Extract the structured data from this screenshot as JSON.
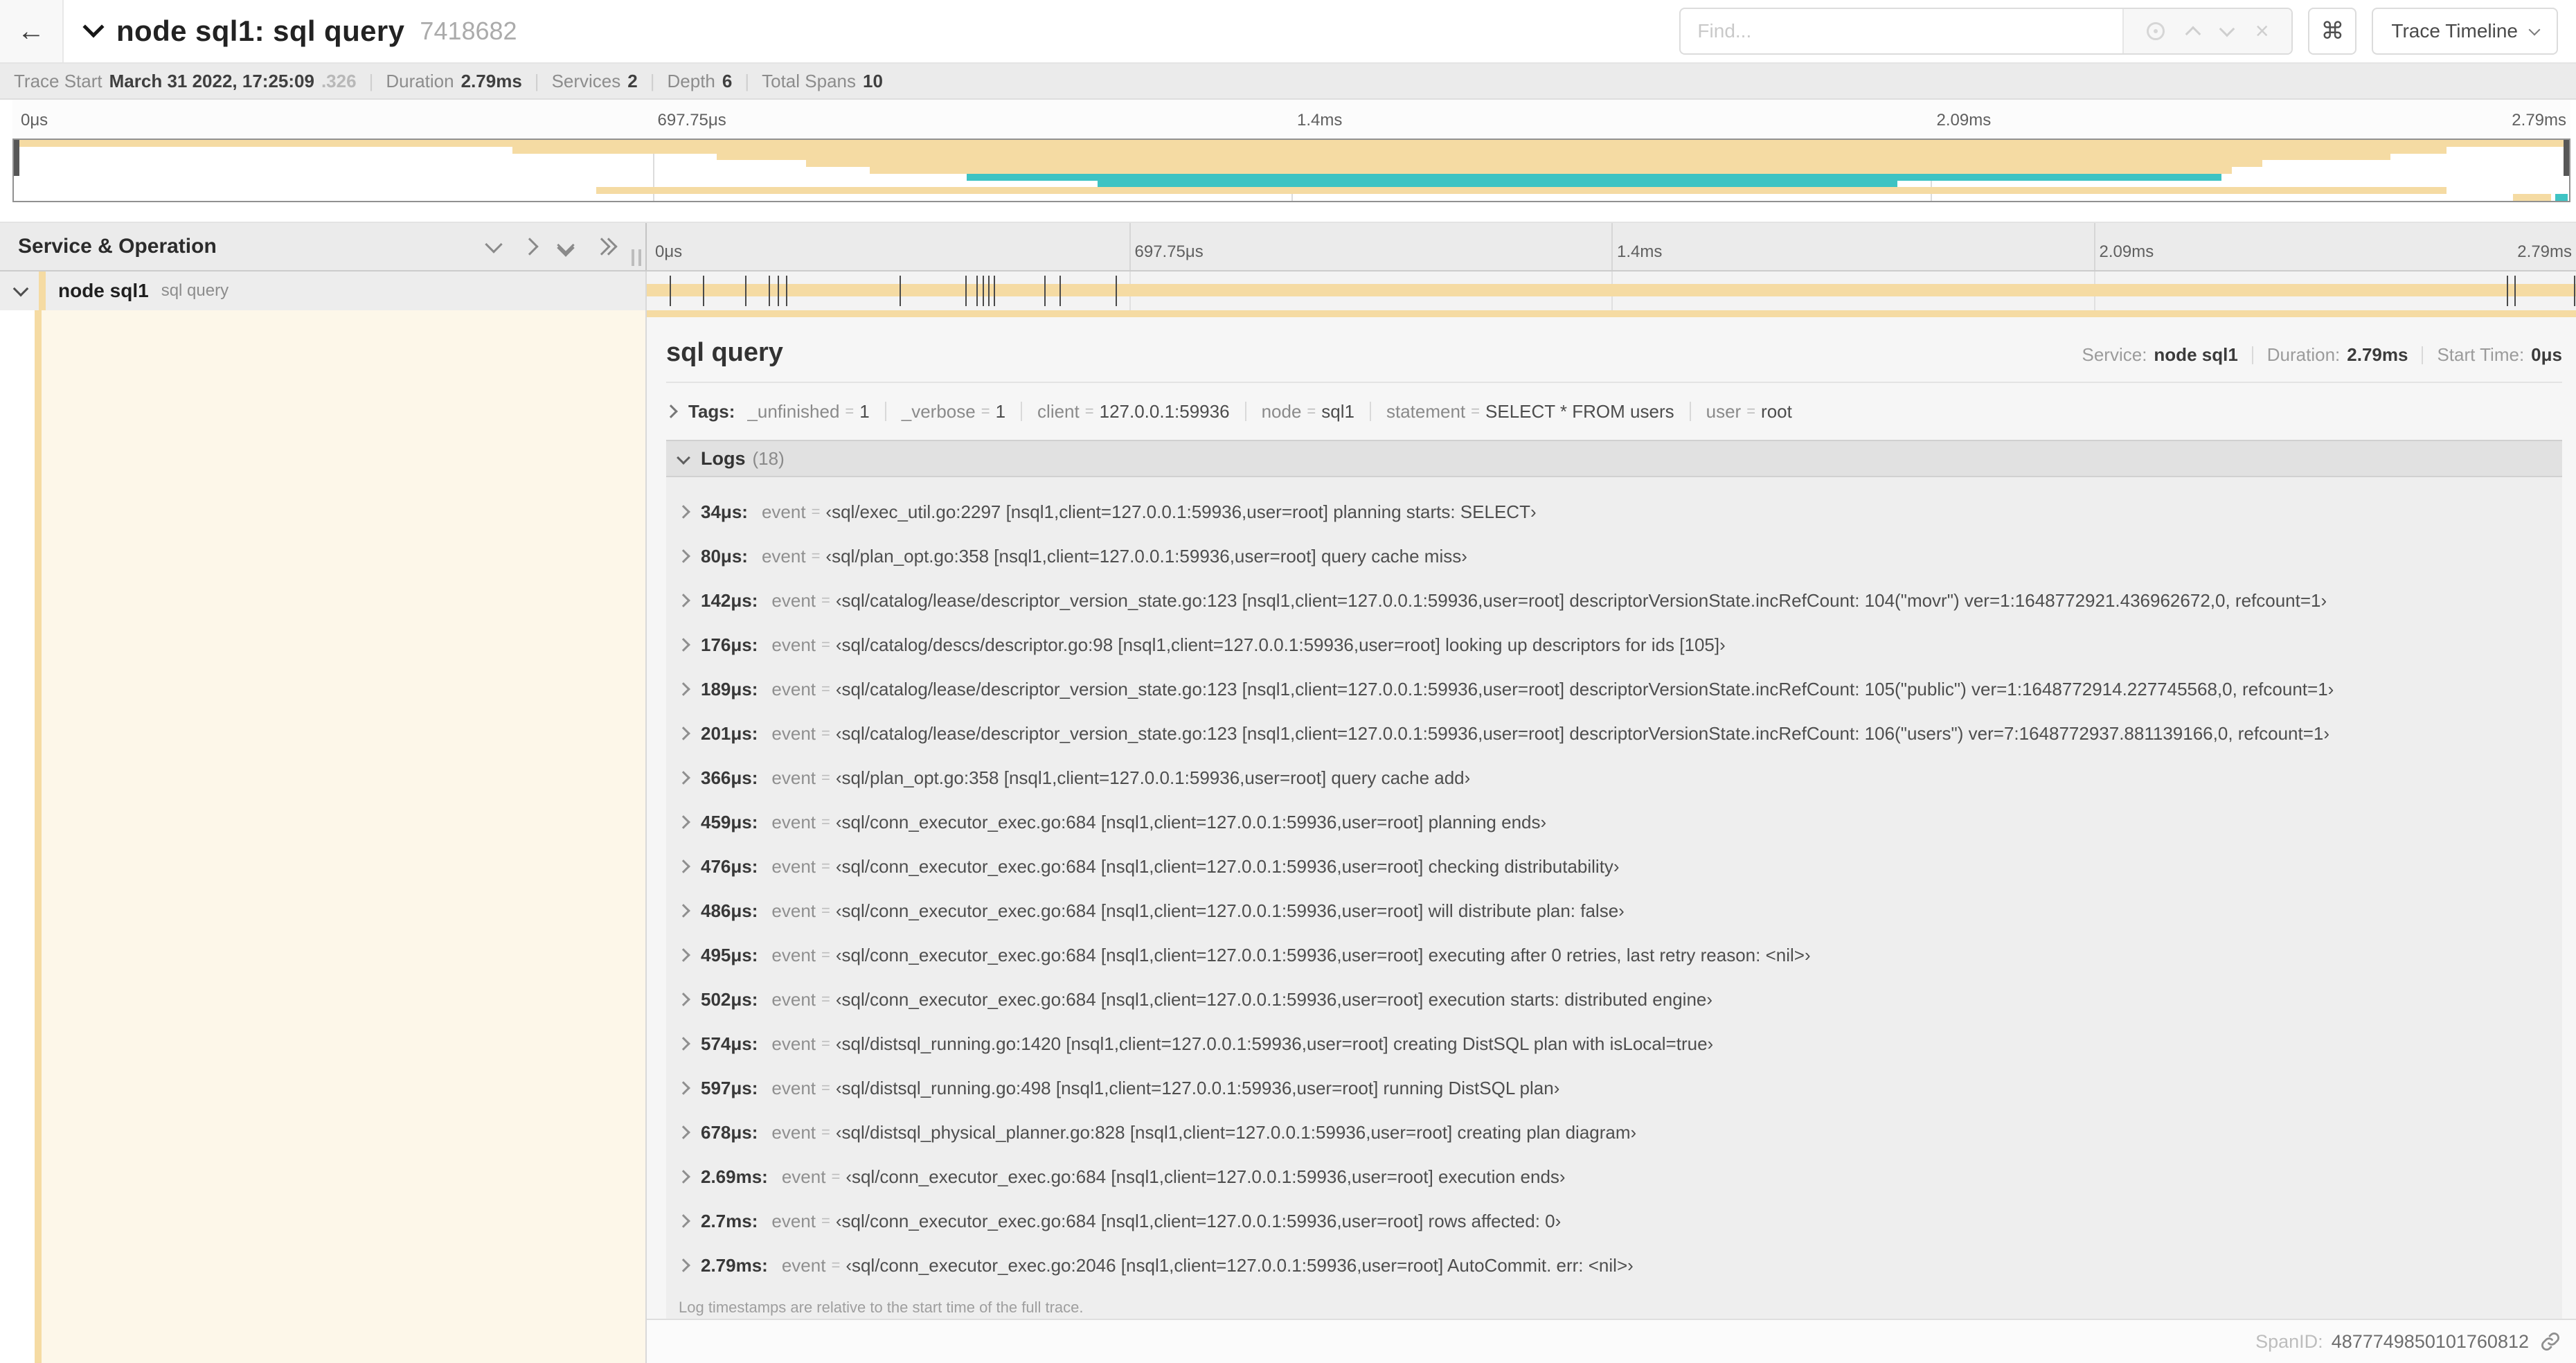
{
  "header": {
    "title": "node sql1: sql query",
    "trace_id": "7418682",
    "back_icon": "←",
    "find_placeholder": "Find...",
    "clear_icon": "×",
    "shortcut_icon": "⌘",
    "view_selector": "Trace Timeline"
  },
  "summary": {
    "items": [
      {
        "label": "Trace Start",
        "value": "March 31 2022, 17:25:09",
        "suffix": ".326"
      },
      {
        "label": "Duration",
        "value": "2.79ms"
      },
      {
        "label": "Services",
        "value": "2"
      },
      {
        "label": "Depth",
        "value": "6"
      },
      {
        "label": "Total Spans",
        "value": "10"
      }
    ]
  },
  "timeline": {
    "ticks": [
      {
        "label": "0μs",
        "pos": 0
      },
      {
        "label": "697.75μs",
        "pos": 25
      },
      {
        "label": "1.4ms",
        "pos": 50
      },
      {
        "label": "2.09ms",
        "pos": 75
      },
      {
        "label": "2.79ms",
        "pos": 100
      }
    ],
    "grid_positions": [
      25,
      50,
      75
    ],
    "minimap_rows": [
      [
        {
          "color": "tan",
          "start": 0,
          "end": 100
        }
      ],
      [
        {
          "color": "tan",
          "start": 19.5,
          "end": 95.2
        }
      ],
      [
        {
          "color": "tan",
          "start": 27.5,
          "end": 93
        }
      ],
      [
        {
          "color": "tan",
          "start": 31,
          "end": 88
        }
      ],
      [
        {
          "color": "tan",
          "start": 33.5,
          "end": 86.8
        }
      ],
      [
        {
          "color": "teal",
          "start": 37.3,
          "end": 86.4
        }
      ],
      [
        {
          "color": "teal",
          "start": 42.4,
          "end": 73.7
        }
      ],
      [
        {
          "color": "tan",
          "start": 22.8,
          "end": 95.2
        }
      ],
      [
        {
          "color": "tan",
          "start": 97.8,
          "end": 99.3
        },
        {
          "color": "teal",
          "start": 99.45,
          "end": 99.95
        }
      ]
    ]
  },
  "span_list": {
    "header": "Service & Operation",
    "row": {
      "service": "node sql1",
      "operation": "sql query"
    }
  },
  "span_row": {
    "bar_start": 0,
    "bar_end": 100,
    "tick_positions": [
      1.2,
      2.9,
      5.1,
      6.3,
      6.8,
      7.2,
      13.1,
      16.5,
      17.1,
      17.4,
      17.7,
      18,
      20.6,
      21.4,
      24.3,
      96.4,
      96.8,
      99.9
    ]
  },
  "detail": {
    "title": "sql query",
    "meta": [
      {
        "label": "Service:",
        "value": "node sql1"
      },
      {
        "label": "Duration:",
        "value": "2.79ms"
      },
      {
        "label": "Start Time:",
        "value": "0μs"
      }
    ],
    "tags_label": "Tags:",
    "tags": [
      {
        "key": "_unfinished",
        "value": "1"
      },
      {
        "key": "_verbose",
        "value": "1"
      },
      {
        "key": "client",
        "value": "127.0.0.1:59936"
      },
      {
        "key": "node",
        "value": "sql1"
      },
      {
        "key": "statement",
        "value": "SELECT * FROM users"
      },
      {
        "key": "user",
        "value": "root"
      }
    ],
    "logs_label": "Logs",
    "logs_count": "(18)",
    "logs": [
      {
        "time": "34μs:",
        "key": "event",
        "value": "‹sql/exec_util.go:2297 [nsql1,client=127.0.0.1:59936,user=root] planning starts: SELECT›"
      },
      {
        "time": "80μs:",
        "key": "event",
        "value": "‹sql/plan_opt.go:358 [nsql1,client=127.0.0.1:59936,user=root] query cache miss›"
      },
      {
        "time": "142μs:",
        "key": "event",
        "value": "‹sql/catalog/lease/descriptor_version_state.go:123 [nsql1,client=127.0.0.1:59936,user=root] descriptorVersionState.incRefCount: 104(\"movr\") ver=1:1648772921.436962672,0, refcount=1›"
      },
      {
        "time": "176μs:",
        "key": "event",
        "value": "‹sql/catalog/descs/descriptor.go:98 [nsql1,client=127.0.0.1:59936,user=root] looking up descriptors for ids [105]›"
      },
      {
        "time": "189μs:",
        "key": "event",
        "value": "‹sql/catalog/lease/descriptor_version_state.go:123 [nsql1,client=127.0.0.1:59936,user=root] descriptorVersionState.incRefCount: 105(\"public\") ver=1:1648772914.227745568,0, refcount=1›"
      },
      {
        "time": "201μs:",
        "key": "event",
        "value": "‹sql/catalog/lease/descriptor_version_state.go:123 [nsql1,client=127.0.0.1:59936,user=root] descriptorVersionState.incRefCount: 106(\"users\") ver=7:1648772937.881139166,0, refcount=1›"
      },
      {
        "time": "366μs:",
        "key": "event",
        "value": "‹sql/plan_opt.go:358 [nsql1,client=127.0.0.1:59936,user=root] query cache add›"
      },
      {
        "time": "459μs:",
        "key": "event",
        "value": "‹sql/conn_executor_exec.go:684 [nsql1,client=127.0.0.1:59936,user=root] planning ends›"
      },
      {
        "time": "476μs:",
        "key": "event",
        "value": "‹sql/conn_executor_exec.go:684 [nsql1,client=127.0.0.1:59936,user=root] checking distributability›"
      },
      {
        "time": "486μs:",
        "key": "event",
        "value": "‹sql/conn_executor_exec.go:684 [nsql1,client=127.0.0.1:59936,user=root] will distribute plan: false›"
      },
      {
        "time": "495μs:",
        "key": "event",
        "value": "‹sql/conn_executor_exec.go:684 [nsql1,client=127.0.0.1:59936,user=root] executing after 0 retries, last retry reason: <nil>›"
      },
      {
        "time": "502μs:",
        "key": "event",
        "value": "‹sql/conn_executor_exec.go:684 [nsql1,client=127.0.0.1:59936,user=root] execution starts: distributed engine›"
      },
      {
        "time": "574μs:",
        "key": "event",
        "value": "‹sql/distsql_running.go:1420 [nsql1,client=127.0.0.1:59936,user=root] creating DistSQL plan with isLocal=true›"
      },
      {
        "time": "597μs:",
        "key": "event",
        "value": "‹sql/distsql_running.go:498 [nsql1,client=127.0.0.1:59936,user=root] running DistSQL plan›"
      },
      {
        "time": "678μs:",
        "key": "event",
        "value": "‹sql/distsql_physical_planner.go:828 [nsql1,client=127.0.0.1:59936,user=root] creating plan diagram›"
      },
      {
        "time": "2.69ms:",
        "key": "event",
        "value": "‹sql/conn_executor_exec.go:684 [nsql1,client=127.0.0.1:59936,user=root] execution ends›"
      },
      {
        "time": "2.7ms:",
        "key": "event",
        "value": "‹sql/conn_executor_exec.go:684 [nsql1,client=127.0.0.1:59936,user=root] rows affected: 0›"
      },
      {
        "time": "2.79ms:",
        "key": "event",
        "value": "‹sql/conn_executor_exec.go:2046 [nsql1,client=127.0.0.1:59936,user=root] AutoCommit. err: <nil>›"
      }
    ],
    "logs_footer": "Log timestamps are relative to the start time of the full trace.",
    "span_id_label": "SpanID:",
    "span_id": "4877749850101760812"
  },
  "colors": {
    "span_tan": "#F5DBA3",
    "span_teal": "#3EC3C3",
    "selection_cream": "#FDF7E9"
  }
}
